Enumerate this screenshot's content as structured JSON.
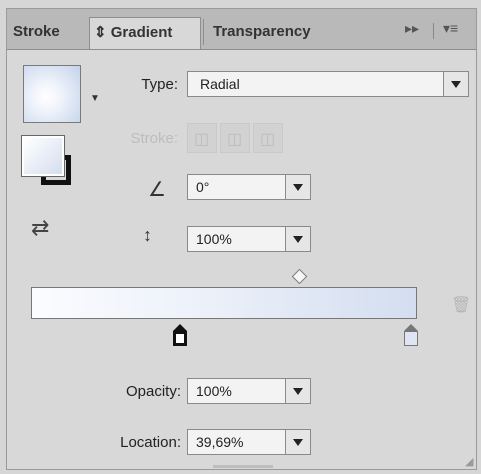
{
  "tabs": [
    {
      "label": "Stroke"
    },
    {
      "label": "Gradient",
      "prefix": "⇕"
    },
    {
      "label": "Transparency"
    }
  ],
  "toolbar": {
    "expand_icon": "▸▸",
    "menu_icon": "▾≡"
  },
  "type": {
    "label": "Type:",
    "value": "Radial"
  },
  "stroke_label": "Stroke:",
  "angle": {
    "icon": "∠",
    "value": "0°"
  },
  "aspect_ratio": {
    "icon": "↕",
    "value": "100%"
  },
  "opacity": {
    "label": "Opacity:",
    "value": "100%"
  },
  "location": {
    "label": "Location:",
    "value": "39,69%"
  },
  "gradient_preview": {
    "start_color": "#fbfcff",
    "end_color": "#d4def0"
  },
  "colors": {
    "panel_bg": "#d8d8d8",
    "tab_bar": "#b9b9b9"
  }
}
